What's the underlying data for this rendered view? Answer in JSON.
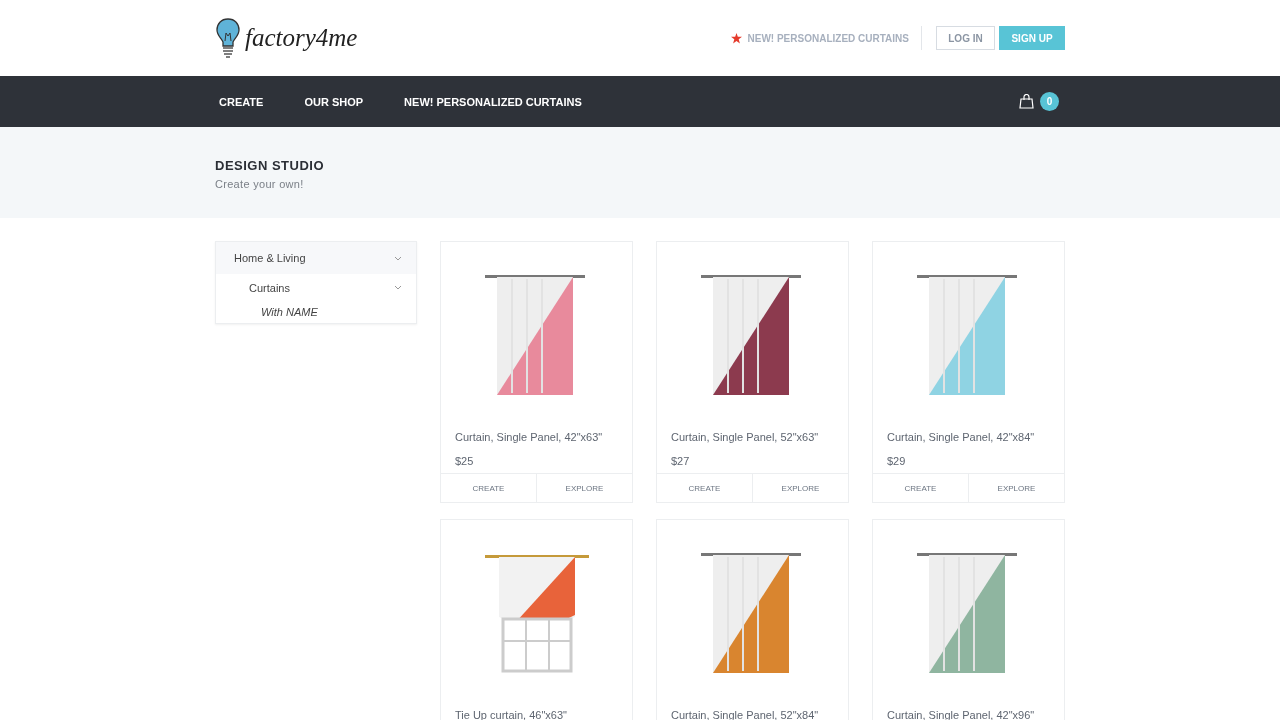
{
  "logo": {
    "text": "factory4me"
  },
  "header_links": [
    {
      "kind": "promo",
      "label": "NEW! PERSONALIZED CURTAINS"
    },
    {
      "kind": "outline",
      "label": "LOG IN"
    },
    {
      "kind": "filled",
      "label": "SIGN UP"
    }
  ],
  "nav": {
    "items": [
      "CREATE",
      "OUR SHOP",
      "NEW! PERSONALIZED CURTAINS"
    ],
    "cart_count": "0"
  },
  "hero": {
    "title": "DESIGN STUDIO",
    "subtitle": "Create your own!"
  },
  "sidebar": {
    "items": [
      {
        "label": "Home & Living",
        "expanded": true,
        "children": [
          {
            "label": "Curtains",
            "expanded": true,
            "children": [
              {
                "label": "With NAME"
              }
            ]
          }
        ]
      }
    ]
  },
  "products": [
    {
      "kind": "panel",
      "color": "#e88a9c",
      "title": "Curtain, Single Panel, 42\"x63\"",
      "price": "$25",
      "actions": [
        "CREATE",
        "EXPLORE"
      ]
    },
    {
      "kind": "panel",
      "color": "#8c3a4e",
      "title": "Curtain, Single Panel, 52\"x63\"",
      "price": "$27",
      "actions": [
        "CREATE",
        "EXPLORE"
      ]
    },
    {
      "kind": "panel",
      "color": "#8fd3e3",
      "title": "Curtain, Single Panel, 42\"x84\"",
      "price": "$29",
      "actions": [
        "CREATE",
        "EXPLORE"
      ]
    },
    {
      "kind": "tieup",
      "color": "#e8633a",
      "title": "Tie Up curtain, 46\"x63\""
    },
    {
      "kind": "panel",
      "color": "#d9852f",
      "title": "Curtain, Single Panel, 52\"x84\""
    },
    {
      "kind": "panel",
      "color": "#8fb5a0",
      "title": "Curtain, Single Panel, 42\"x96\""
    }
  ]
}
